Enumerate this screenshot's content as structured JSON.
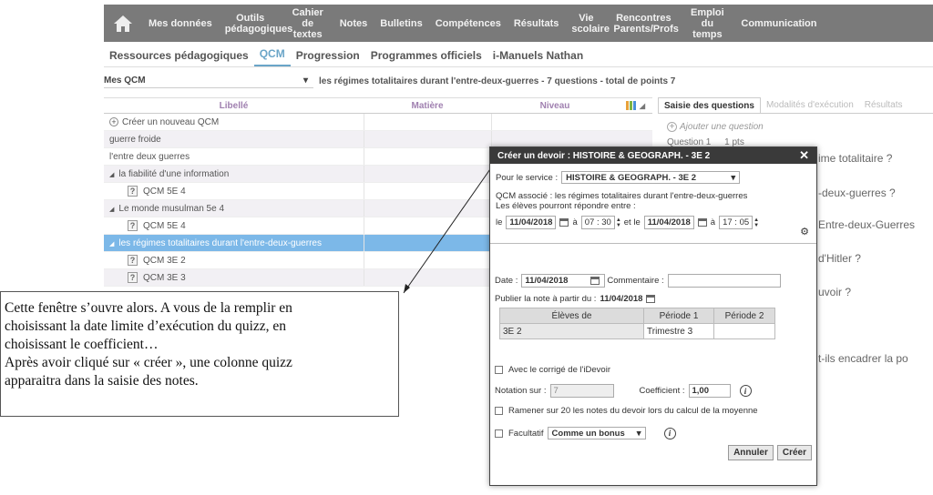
{
  "topnav": {
    "items": [
      "Mes données",
      "Outils pédagogiques",
      "Cahier de textes",
      "Notes",
      "Bulletins",
      "Compétences",
      "Résultats",
      "Vie scolaire",
      "Rencontres Parents/Profs",
      "Emploi du temps",
      "Communication"
    ]
  },
  "subnav": {
    "items": [
      "Ressources pédagogiques",
      "QCM",
      "Progression",
      "Programmes officiels",
      "i-Manuels Nathan"
    ],
    "active": "QCM"
  },
  "qcmbar": {
    "select": "Mes QCM",
    "title": "les régimes totalitaires durant l'entre-deux-guerres - 7 questions - total de points 7"
  },
  "grid": {
    "headers": [
      "Libellé",
      "Matière",
      "Niveau"
    ],
    "rows": [
      {
        "label": "Créer un nouveau QCM",
        "type": "create"
      },
      {
        "label": "guerre froide",
        "type": "plain"
      },
      {
        "label": "l'entre deux guerres",
        "type": "plain"
      },
      {
        "label": "la fiabilité d'une information",
        "type": "group"
      },
      {
        "label": "QCM  5E 4",
        "type": "child"
      },
      {
        "label": "Le monde musulman 5e 4",
        "type": "group"
      },
      {
        "label": "QCM  5E 4",
        "type": "child"
      },
      {
        "label": "les régimes totalitaires durant l'entre-deux-guerres",
        "type": "selected"
      },
      {
        "label": "QCM  3E 2",
        "type": "child"
      },
      {
        "label": "QCM  3E 3",
        "type": "child"
      }
    ]
  },
  "right": {
    "tabs": [
      "Saisie des questions",
      "Modalités d'exécution",
      "Résultats"
    ],
    "add_question": "Ajouter une question",
    "question1": "Question 1",
    "question1_pts": "1 pts",
    "fragments": [
      "ime totalitaire ?",
      "-deux-guerres ?",
      "Entre-deux-Guerres",
      "d'Hitler ?",
      "uvoir ?",
      "t-ils encadrer la po"
    ]
  },
  "callout": {
    "lines": [
      "Cette fenêtre s’ouvre alors. A vous de la remplir en",
      "choisissant la date limite d’exécution du quizz, en",
      "choisissant le coefficient…",
      "Après avoir cliqué sur « créer », une colonne quizz",
      "apparaitra dans la saisie des notes."
    ]
  },
  "dialog": {
    "title": "Créer un devoir : HISTOIRE & GEOGRAPH. - 3E 2",
    "service_label": "Pour le service :",
    "service_value": "HISTOIRE & GEOGRAPH. - 3E 2",
    "qcm_assoc": "QCM associé : les régimes totalitaires durant l'entre-deux-guerres",
    "eleves_between": "Les élèves pourront répondre entre :",
    "le": "le",
    "date_start": "11/04/2018",
    "a1": "à",
    "h_start": "07",
    "m_start": "30",
    "et_le": "et le",
    "date_end": "11/04/2018",
    "a2": "à",
    "h_end": "17",
    "m_end": "05",
    "date_label": "Date :",
    "date_value": "11/04/2018",
    "comment_label": "Commentaire :",
    "publish_label": "Publier la note à partir du :",
    "publish_value": "11/04/2018",
    "table_headers": [
      "Élèves de",
      "Période 1",
      "Période 2"
    ],
    "table_row": [
      "3E 2",
      "Trimestre 3",
      ""
    ],
    "corrige": "Avec le corrigé de l'iDevoir",
    "notation_label": "Notation sur :",
    "notation_value": "7",
    "coef_label": "Coefficient :",
    "coef_value": "1,00",
    "ramener": "Ramener sur 20 les notes du devoir lors du calcul de la moyenne",
    "facultatif": "Facultatif",
    "facultatif_value": "Comme un bonus",
    "cancel": "Annuler",
    "create": "Créer"
  }
}
